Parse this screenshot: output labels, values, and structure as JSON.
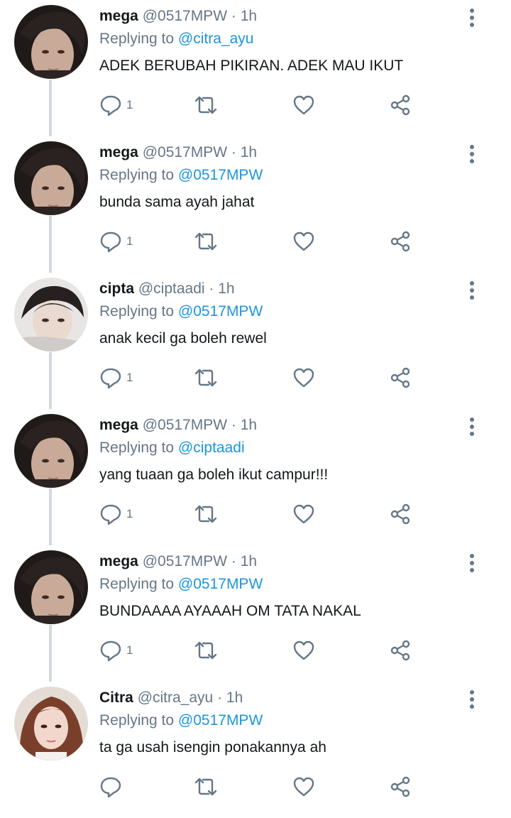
{
  "replying_prefix": "Replying to",
  "tweets": [
    {
      "name": "mega",
      "handle": "@0517MPW",
      "time": "1h",
      "reply_to": "@citra_ayu",
      "text": "ADEK BERUBAH PIKIRAN. ADEK MAU IKUT",
      "reply_count": "1",
      "avatar": "mega"
    },
    {
      "name": "mega",
      "handle": "@0517MPW",
      "time": "1h",
      "reply_to": "@0517MPW",
      "text": "bunda sama ayah jahat",
      "reply_count": "1",
      "avatar": "mega"
    },
    {
      "name": "cipta",
      "handle": "@ciptaadi",
      "time": "1h",
      "reply_to": "@0517MPW",
      "text": "anak kecil ga boleh rewel",
      "reply_count": "1",
      "avatar": "cipta"
    },
    {
      "name": "mega",
      "handle": "@0517MPW",
      "time": "1h",
      "reply_to": "@ciptaadi",
      "text": "yang tuaan ga boleh ikut campur!!!",
      "reply_count": "1",
      "avatar": "mega"
    },
    {
      "name": "mega",
      "handle": "@0517MPW",
      "time": "1h",
      "reply_to": "@0517MPW",
      "text": "BUNDAAAA AYAAAH OM TATA NAKAL",
      "reply_count": "1",
      "avatar": "mega"
    },
    {
      "name": "Citra",
      "handle": "@citra_ayu",
      "time": "1h",
      "reply_to": "@0517MPW",
      "text": "ta ga usah isengin ponakannya ah",
      "reply_count": "",
      "avatar": "citra"
    }
  ],
  "icons": {
    "reply": "reply-icon",
    "retweet": "retweet-icon",
    "like": "like-icon",
    "share": "share-icon",
    "more": "more-vertical-icon"
  },
  "colors": {
    "name": "#14171a",
    "meta": "#657786",
    "mention": "#1b95e0",
    "thread_line": "#d4d9dd"
  }
}
